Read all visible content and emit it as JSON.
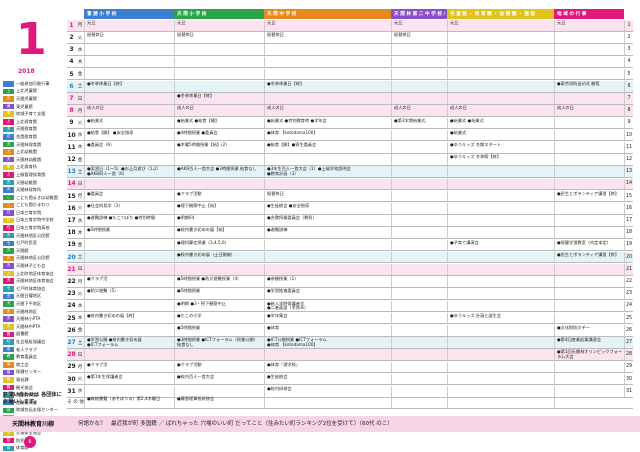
{
  "month": "1",
  "year": "2018",
  "colors": {
    "accent": "#e0187a",
    "sunday_bg": "#fbe3ef",
    "saturday_bg": "#e4f3f8"
  },
  "columns": [
    {
      "label": "曹 勝 小 学 校",
      "color": "#3a7fd0"
    },
    {
      "label": "天 間 小 学 校",
      "color": "#2aa44b"
    },
    {
      "label": "天 間 中 学 校",
      "color": "#e58a1f"
    },
    {
      "label": "天 間 林 第 二 中 学 校 / 天 間 林 第 二 小 学 校",
      "color": "#8a4fc8"
    },
    {
      "label": "児 童 館 ・ 保 育 園 ・ 幼 稚 園 ・ 施 設",
      "color": "#e3c21e"
    },
    {
      "label": "地 域 の 行 事",
      "color": "#e0187a"
    }
  ],
  "legend": [
    {
      "tag": "",
      "label": "一般参加可能行事"
    },
    {
      "tag": "上",
      "label": "上北児童館"
    },
    {
      "tag": "天",
      "label": "天間児童館"
    },
    {
      "tag": "東",
      "label": "東児童館"
    },
    {
      "tag": "甲",
      "label": "地域子育て支援"
    },
    {
      "tag": "上",
      "label": "上北保育園"
    },
    {
      "tag": "天",
      "label": "天間保育園"
    },
    {
      "tag": "花",
      "label": "花園保育園"
    },
    {
      "tag": "天",
      "label": "天間林保育園"
    },
    {
      "tag": "上",
      "label": "上北幼稚園"
    },
    {
      "tag": "天",
      "label": "天間林幼稚園"
    },
    {
      "tag": "甲",
      "label": "上北保育所"
    },
    {
      "tag": "上",
      "label": "上級管理保育園"
    },
    {
      "tag": "天",
      "label": "天間幼稚園"
    },
    {
      "tag": "天",
      "label": "天間林保育所"
    },
    {
      "tag": "こ",
      "label": "こども園まきば幼稚園"
    },
    {
      "tag": "こ",
      "label": "こども園ひまわり"
    },
    {
      "tag": "日",
      "label": "日本三育学院"
    },
    {
      "tag": "日",
      "label": "日本三育学院中学校"
    },
    {
      "tag": "日",
      "label": "日本三育学院高校"
    },
    {
      "tag": "天",
      "label": "天間林地区公民館"
    },
    {
      "tag": "七",
      "label": "七戸町民室"
    },
    {
      "tag": "天",
      "label": "天間館"
    },
    {
      "tag": "天",
      "label": "天間林地区公民館"
    },
    {
      "tag": "天",
      "label": "天間林子ども会"
    },
    {
      "tag": "上",
      "label": "上北町地区体育協会"
    },
    {
      "tag": "天",
      "label": "天間林地区体育協会"
    },
    {
      "tag": "七",
      "label": "七戸町体育協会"
    },
    {
      "tag": "天",
      "label": "天間日曜地区"
    },
    {
      "tag": "天",
      "label": "天間下平地区"
    },
    {
      "tag": "天",
      "label": "天間林地区"
    },
    {
      "tag": "天",
      "label": "天間林小PTA"
    },
    {
      "tag": "天",
      "label": "天間林中PTA"
    },
    {
      "tag": "図",
      "label": "図書館"
    },
    {
      "tag": "社",
      "label": "社会福祉協議会"
    },
    {
      "tag": "老",
      "label": "老人クラブ"
    },
    {
      "tag": "教",
      "label": "教育委員会"
    },
    {
      "tag": "商",
      "label": "商工会"
    },
    {
      "tag": "保",
      "label": "保健センター"
    },
    {
      "tag": "福",
      "label": "福祉課"
    },
    {
      "tag": "観",
      "label": "観光協会"
    },
    {
      "tag": "農",
      "label": "農業委員会"
    },
    {
      "tag": "産",
      "label": "産業振興課"
    },
    {
      "tag": "地",
      "label": "地域包括支援センター"
    },
    {
      "tag": "シ",
      "label": "シルバー人材センター"
    },
    {
      "tag": "消",
      "label": "消防団"
    },
    {
      "tag": "交",
      "label": "交通安全協会"
    },
    {
      "tag": "防",
      "label": "防犯協会"
    },
    {
      "tag": "体",
      "label": "体育館"
    },
    {
      "tag": "ス",
      "label": "スポーツ推進委員"
    },
    {
      "tag": "文",
      "label": "文化協会"
    }
  ],
  "contact": "お問い合わせは 各団体にお願いします。",
  "days": [
    {
      "d": "1",
      "w": "月",
      "t": "hol",
      "c": [
        "元旦",
        "元旦",
        "元旦",
        "元旦",
        "元旦",
        "元旦"
      ]
    },
    {
      "d": "2",
      "w": "火",
      "t": "",
      "c": [
        "振替休日",
        "振替休日",
        "振替休日",
        "振替休日",
        "",
        ""
      ]
    },
    {
      "d": "3",
      "w": "水",
      "t": "",
      "c": [
        "",
        "",
        "",
        "",
        "",
        ""
      ]
    },
    {
      "d": "4",
      "w": "木",
      "t": "",
      "c": [
        "",
        "",
        "",
        "",
        "",
        ""
      ]
    },
    {
      "d": "5",
      "w": "金",
      "t": "",
      "c": [
        "",
        "",
        "",
        "",
        "",
        ""
      ]
    },
    {
      "d": "6",
      "w": "土",
      "t": "sat",
      "c": [
        "●冬季休業日【終】",
        "",
        "●冬季休業日【終】",
        "",
        "",
        "●東京消防出初式 観覧"
      ]
    },
    {
      "d": "7",
      "w": "日",
      "t": "sun",
      "c": [
        "",
        "●冬季休業日【終】",
        "",
        "",
        "",
        ""
      ]
    },
    {
      "d": "8",
      "w": "月",
      "t": "hol",
      "c": [
        "成人の日",
        "成人の日",
        "成人の日",
        "成人の日",
        "成人の日",
        "成人の日"
      ]
    },
    {
      "d": "9",
      "w": "火",
      "t": "",
      "c": [
        "●始業式",
        "●始業式 ●給食【開】",
        "●始業式 ●特別教育時 ●学年会",
        "●第3学期始業式",
        "●始業式 ●始業式",
        ""
      ]
    },
    {
      "d": "10",
      "w": "水",
      "t": "",
      "c": [
        "●給食【開】 ●安全指導",
        "●4時間授業 ●委員会",
        "●体育 【kotodama100】",
        "",
        "●始業式",
        ""
      ]
    },
    {
      "d": "11",
      "w": "木",
      "t": "",
      "c": [
        "●委員会（6）",
        "●木曜5時間授業【始】(2)",
        "●給食【開】●寄生委員会",
        "",
        "●ゆうキッズ 冬期スタート",
        ""
      ]
    },
    {
      "d": "12",
      "w": "金",
      "t": "",
      "c": [
        "",
        "",
        "",
        "",
        "●ゆうキッズ 冬休暇【終】",
        ""
      ]
    },
    {
      "d": "13",
      "w": "土",
      "t": "sat",
      "c": [
        "●実習日（1〜5）●お正月遊び（1,2）\n●AKB四人一首（6）",
        "●AKB百人一首大会 ●3時間授業 給食なし",
        "●3年生百人一首大会（1）●上級学校説明会\n●教育計画（3）",
        "",
        "",
        ""
      ]
    },
    {
      "d": "14",
      "w": "日",
      "t": "sun",
      "c": [
        "",
        "",
        "",
        "",
        "",
        ""
      ]
    },
    {
      "d": "15",
      "w": "月",
      "t": "",
      "c": [
        "●委員会",
        "●クラブ活動",
        "振替休日",
        "",
        "",
        "●民生とボランティア講習【終】"
      ]
    },
    {
      "d": "16",
      "w": "火",
      "t": "",
      "c": [
        "●社会科見学（3）",
        "●理下観察中止【始】",
        "●生徒総会 ●安全指導",
        "",
        "",
        ""
      ]
    },
    {
      "d": "17",
      "w": "水",
      "t": "",
      "c": [
        "●避難訓練 ●たこつぼり ●特別時間",
        "●明朗64",
        "●名教授業委員会（教科）",
        "",
        "",
        ""
      ]
    },
    {
      "d": "18",
      "w": "木",
      "t": "",
      "c": [
        "●5時間授業",
        "●校内書き初めの展【始】",
        "●避難訓練",
        "",
        "",
        ""
      ]
    },
    {
      "d": "19",
      "w": "金",
      "t": "",
      "c": [
        "",
        "●理科算定授業（3,4,5,6）",
        "",
        "",
        "●子育て講演会",
        "●保健学習教室（内定本定）"
      ]
    },
    {
      "d": "20",
      "w": "土",
      "t": "sat",
      "c": [
        "",
        "●校内書き初め展（土日開催）",
        "",
        "",
        "",
        "●民生とボランティア講習【終】"
      ]
    },
    {
      "d": "21",
      "w": "日",
      "t": "sun",
      "c": [
        "",
        "",
        "",
        "",
        "",
        ""
      ]
    },
    {
      "d": "22",
      "w": "月",
      "t": "",
      "c": [
        "●クラブ活",
        "●5時間授業 ●防災避難授業（4）",
        "●参観授業（1）",
        "",
        "",
        ""
      ]
    },
    {
      "d": "23",
      "w": "火",
      "t": "",
      "c": [
        "●防災避難（5）",
        "●5時間授業",
        "●学習推進委員会",
        "",
        "",
        ""
      ]
    },
    {
      "d": "24",
      "w": "水",
      "t": "",
      "c": [
        "",
        "●明朗 ●3・授下観察中止",
        "●新入学時保護者会\n●二者面談（冬休み）",
        "",
        "",
        ""
      ]
    },
    {
      "d": "25",
      "w": "木",
      "t": "",
      "c": [
        "●校内書き初めの展【終】",
        "●たこの小学",
        "●学年集会",
        "",
        "●ゆうキッズ 計画と誕生会",
        ""
      ]
    },
    {
      "d": "26",
      "w": "金",
      "t": "",
      "c": [
        "",
        "●5時間授業",
        "●体育",
        "",
        "",
        "●文化財防災デー"
      ]
    },
    {
      "d": "27",
      "w": "土",
      "t": "sat",
      "c": [
        "●学習公開 ●校内書き初め展\n●ICTフォーラム",
        "●3時間授業 ●ICTフォーラム（授業公開）\n給食なし",
        "●ICT公開授業 ●ICTフォーラム\n●体育 【kotodama100】",
        "",
        "",
        "●第4回産業起業講習会"
      ]
    },
    {
      "d": "28",
      "w": "日",
      "t": "sun",
      "c": [
        "",
        "",
        "",
        "",
        "",
        "●第1回天間林オリンピックフォーラム大会"
      ]
    },
    {
      "d": "29",
      "w": "月",
      "t": "",
      "c": [
        "●クラブ活",
        "●クラブ活動",
        "●体育「理学校」",
        "",
        "",
        ""
      ]
    },
    {
      "d": "30",
      "w": "火",
      "t": "",
      "c": [
        "●第1年生保護者会",
        "●校内百人一首大会",
        "●生徒総会",
        "",
        "",
        ""
      ]
    },
    {
      "d": "31",
      "w": "水",
      "t": "",
      "c": [
        "",
        "",
        "●校内研修会",
        "",
        "",
        ""
      ]
    }
  ],
  "other": {
    "label": "そ の 他",
    "c": [
      "●森総書籍（あそぼうる）第2,4木曜日",
      "●藤島理事長研修会",
      "",
      "",
      "",
      ""
    ]
  },
  "footer": {
    "label": "天間林教育川柳",
    "text": "何語かな？　最近我が町 多国籍 ／ ばれちゃった 穴場のいい町 だってこと（住みたい町ランキング2位を受けて）（60代 のこ）"
  },
  "page_number": "6"
}
